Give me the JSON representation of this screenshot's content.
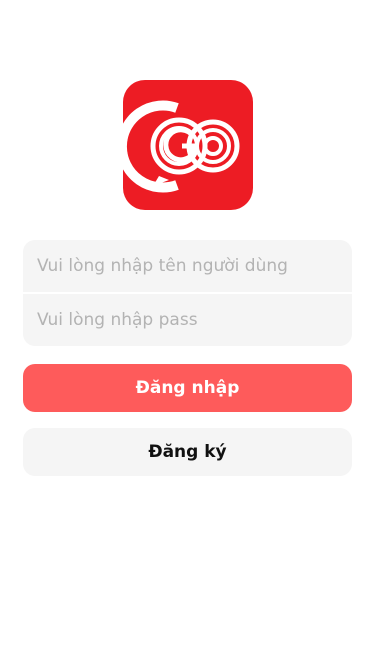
{
  "app": {
    "logo_text": "GO",
    "brand_color": "#ed1c24"
  },
  "form": {
    "username": {
      "placeholder": "Vui lòng nhập tên người dùng",
      "value": ""
    },
    "password": {
      "placeholder": "Vui lòng nhập pass",
      "value": ""
    }
  },
  "buttons": {
    "login_label": "Đăng nhập",
    "login_color": "#fe5b5b",
    "register_label": "Đăng ký",
    "register_color": "#f5f5f5"
  }
}
